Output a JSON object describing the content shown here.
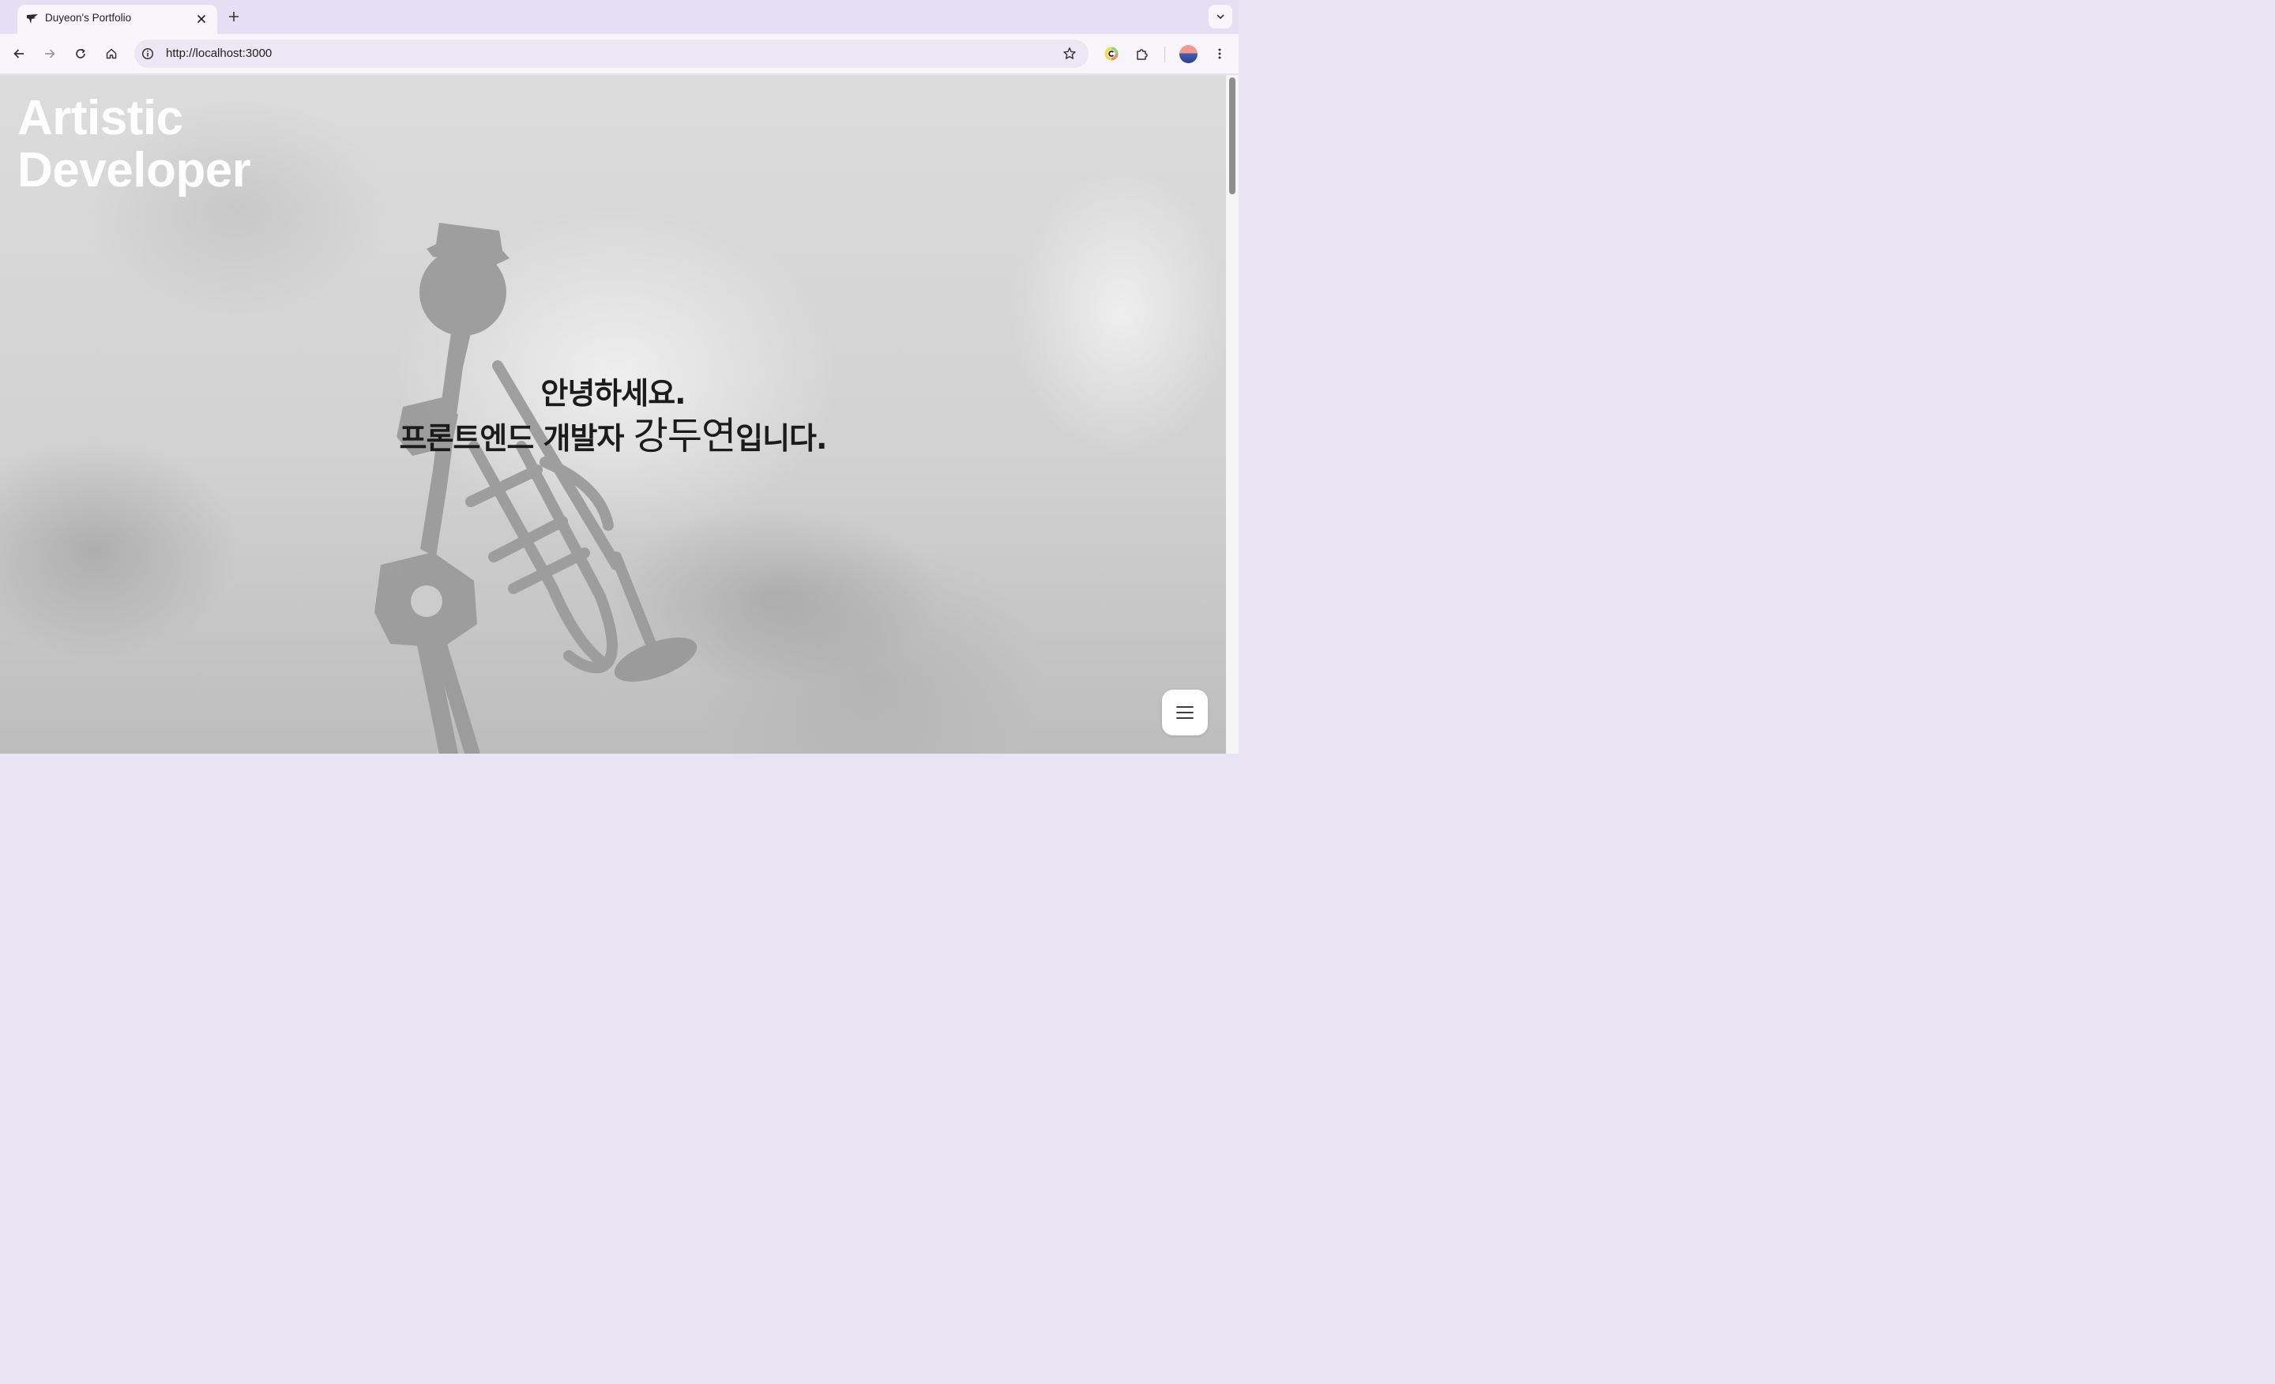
{
  "browser": {
    "tab": {
      "title": "Duyeon's Portfolio",
      "favicon": "bird-icon",
      "close_icon": "close-icon"
    },
    "new_tab_icon": "plus-icon",
    "tab_search_icon": "chevron-down-icon",
    "toolbar": {
      "back_icon": "arrow-left-icon",
      "forward_icon": "arrow-right-icon",
      "reload_icon": "reload-icon",
      "home_icon": "home-icon",
      "url": "http://localhost:3000",
      "site_info_icon": "info-icon",
      "bookmark_icon": "star-icon",
      "extension_badge_icon": "colorful-c-extension-icon",
      "extensions_icon": "puzzle-icon",
      "menu_icon": "kebab-menu-icon"
    },
    "colors": {
      "tabstrip_bg": "#e6dff4",
      "toolbar_bg": "#f8f6fb",
      "omnibox_bg": "#ece7f4"
    }
  },
  "page": {
    "hero_title": {
      "line1": "Artistic",
      "line2": "Developer"
    },
    "greeting": {
      "line1": "안녕하세요.",
      "line2_prefix": "프론트엔드 개발자 ",
      "line2_name": "강두연",
      "line2_suffix": "입니다."
    },
    "menu_button_icon": "hamburger-menu-icon",
    "colors": {
      "hero_title": "#ffffff",
      "greeting_text": "#1b1b1b",
      "background": "#d6d6d6"
    }
  }
}
